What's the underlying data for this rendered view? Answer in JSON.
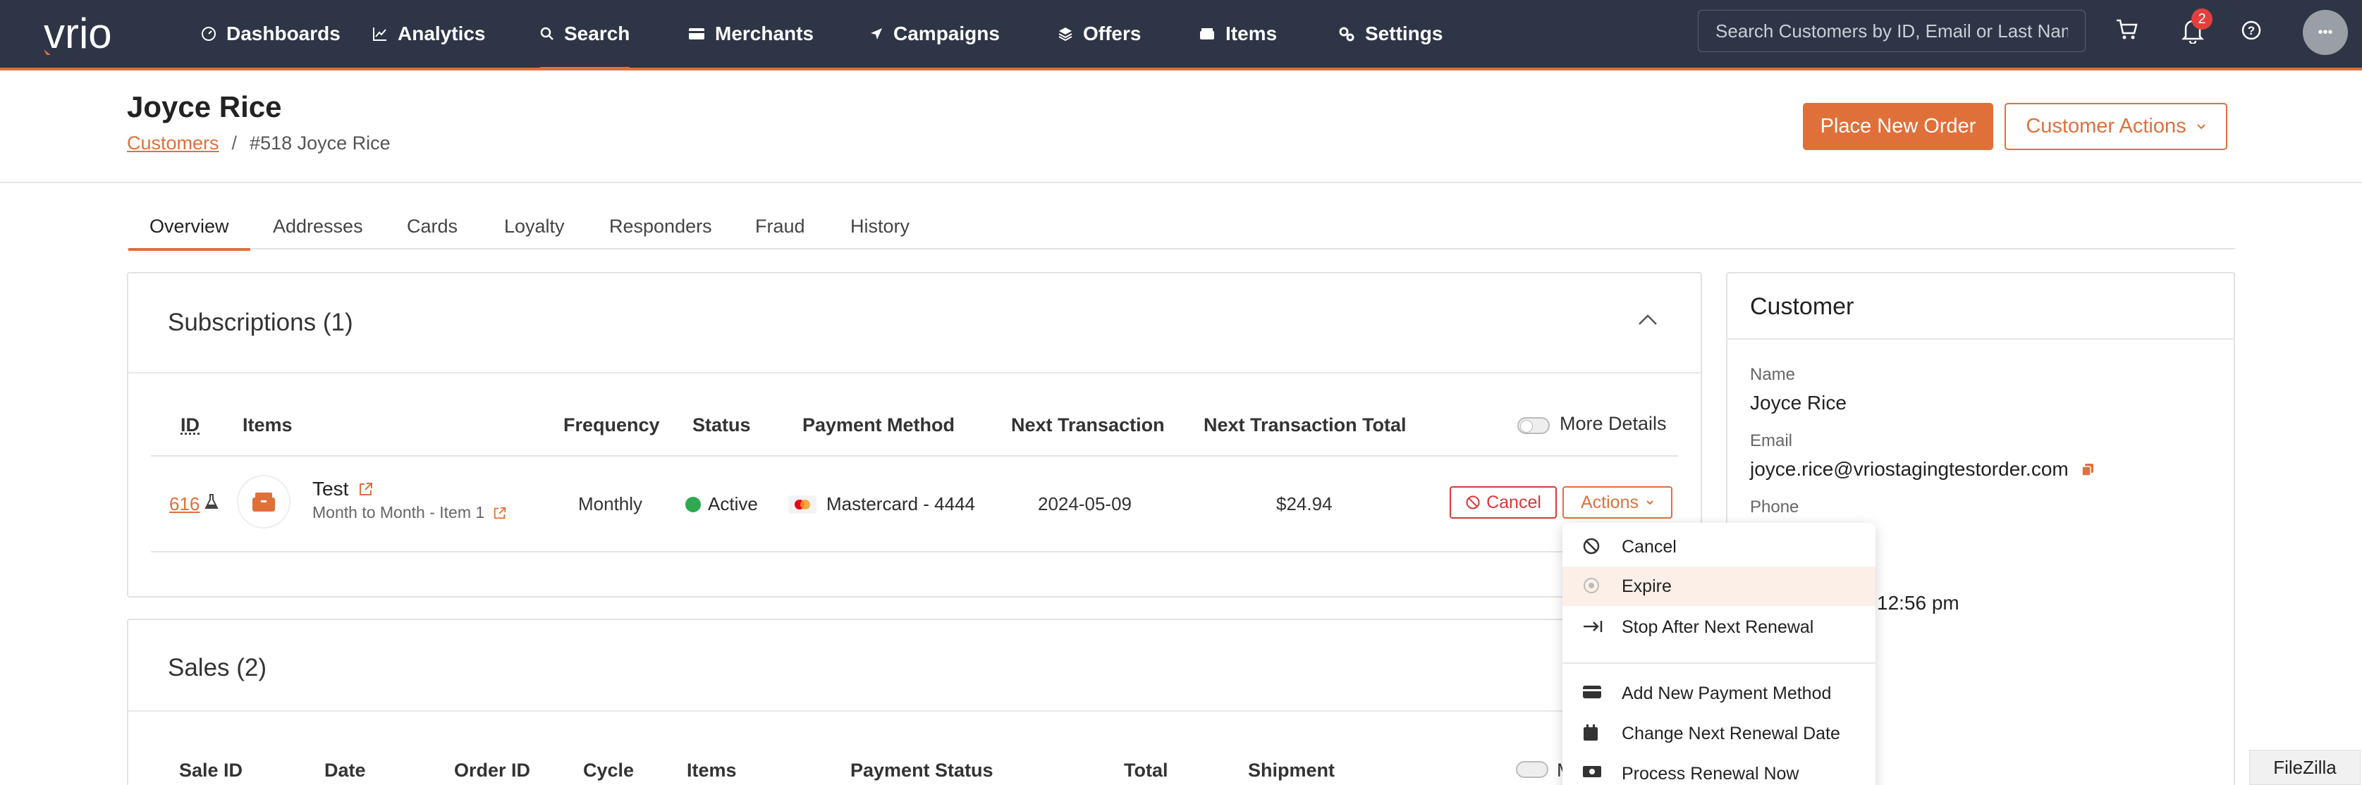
{
  "nav": {
    "logo": "vrio",
    "items": [
      {
        "label": "Dashboards",
        "icon": "dashboard-icon"
      },
      {
        "label": "Analytics",
        "icon": "chart-icon"
      },
      {
        "label": "Search",
        "icon": "search-icon",
        "active": true
      },
      {
        "label": "Merchants",
        "icon": "card-icon"
      },
      {
        "label": "Campaigns",
        "icon": "send-icon"
      },
      {
        "label": "Offers",
        "icon": "layers-icon"
      },
      {
        "label": "Items",
        "icon": "box-icon"
      },
      {
        "label": "Settings",
        "icon": "gears-icon"
      }
    ],
    "search_placeholder": "Search Customers by ID, Email or Last Name",
    "notification_count": "2",
    "avatar_text": "•••"
  },
  "header": {
    "title": "Joyce Rice",
    "breadcrumb": [
      "Customers",
      "/",
      "#518 Joyce Rice"
    ],
    "place_order": "Place New Order",
    "customer_actions": "Customer Actions"
  },
  "tabs": [
    "Overview",
    "Addresses",
    "Cards",
    "Loyalty",
    "Responders",
    "Fraud",
    "History"
  ],
  "subscriptions": {
    "title": "Subscriptions (1)",
    "more_details": "More Details",
    "columns": [
      "ID",
      "Items",
      "Frequency",
      "Status",
      "Payment Method",
      "Next Transaction",
      "Next Transaction Total"
    ],
    "row": {
      "id": "616",
      "item_name": "Test",
      "item_sub": "Month to Month - Item 1",
      "frequency": "Monthly",
      "status": "Active",
      "payment": "Mastercard - 4444",
      "next_transaction": "2024-05-09",
      "next_total": "$24.94",
      "cancel": "Cancel",
      "actions": "Actions"
    }
  },
  "sales": {
    "title": "Sales (2)",
    "columns": [
      "Sale ID",
      "Date",
      "Order ID",
      "Cycle",
      "Items",
      "Payment Status",
      "Total",
      "Shipment"
    ],
    "more_details_partial": "M"
  },
  "customer": {
    "title": "Customer",
    "name_label": "Name",
    "name": "Joyce Rice",
    "email_label": "Email",
    "email": "joyce.rice@vriostagingtestorder.com",
    "phone_label": "Phone",
    "partial_time": "12:56 pm"
  },
  "actions_menu": [
    {
      "label": "Cancel",
      "icon": "ban-icon"
    },
    {
      "label": "Expire",
      "icon": "expire-icon",
      "highlighted": true
    },
    {
      "label": "Stop After Next Renewal",
      "icon": "arrow-stop-icon"
    },
    {
      "label": "Add New Payment Method",
      "icon": "credit-card-icon"
    },
    {
      "label": "Change Next Renewal Date",
      "icon": "calendar-icon"
    },
    {
      "label": "Process Renewal Now",
      "icon": "cash-icon"
    }
  ],
  "taskbar_app": "FileZilla",
  "colors": {
    "accent": "#e0703a",
    "nav_bg": "#2d3546",
    "active_green": "#2fa84f",
    "danger": "#d63a3a"
  }
}
